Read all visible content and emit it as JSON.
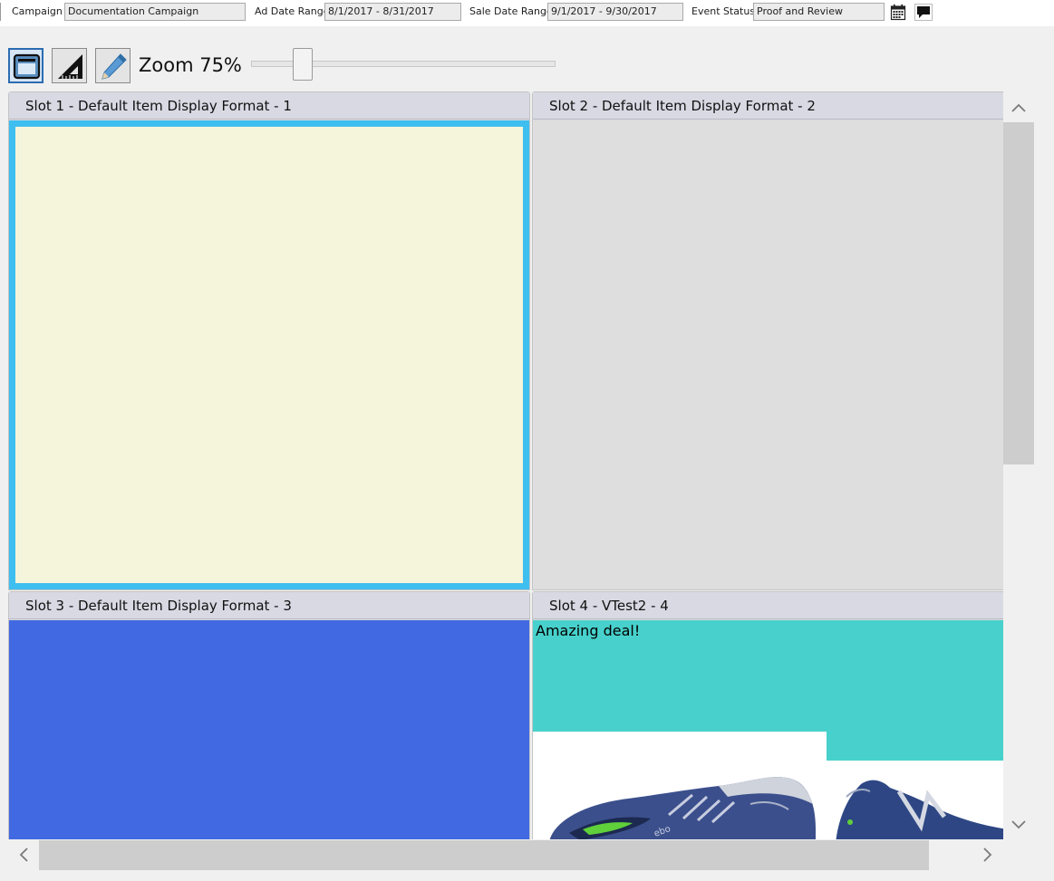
{
  "header": {
    "campaign_label": "Campaign",
    "campaign_value": "Documentation Campaign",
    "ad_date_label": "Ad Date Range",
    "ad_date_value": "8/1/2017 - 8/31/2017",
    "sale_date_label": "Sale Date Range",
    "sale_date_value": "9/1/2017 - 9/30/2017",
    "event_status_label": "Event Status",
    "event_status_value": "Proof and Review",
    "icons": [
      "calendar-icon",
      "comment-icon"
    ]
  },
  "toolbar": {
    "buttons": [
      {
        "icon": "layout-view-icon",
        "active": true
      },
      {
        "icon": "set-square-icon",
        "active": false
      },
      {
        "icon": "pencil-icon",
        "active": false
      }
    ],
    "zoom_label": "Zoom 75%",
    "zoom_percent": 75
  },
  "slots": [
    {
      "title": "Slot 1 - Default Item Display Format - 1",
      "background": "#f5f5dc",
      "selected": true,
      "selection_color": "#3fbef0"
    },
    {
      "title": "Slot 2 - Default Item Display Format - 2",
      "background": "#dedede",
      "selected": false
    },
    {
      "title": "Slot 3 - Default Item Display Format - 3",
      "background": "#4169e1",
      "selected": false
    },
    {
      "title": "Slot 4 - VTest2 - 4",
      "background": "#48d1cc",
      "selected": false,
      "promo_text": "Amazing deal!",
      "images": [
        "running-shoe-image",
        "running-shoe-image"
      ]
    }
  ],
  "scrollbars": {
    "vertical_position": 0,
    "horizontal_position": 0
  }
}
